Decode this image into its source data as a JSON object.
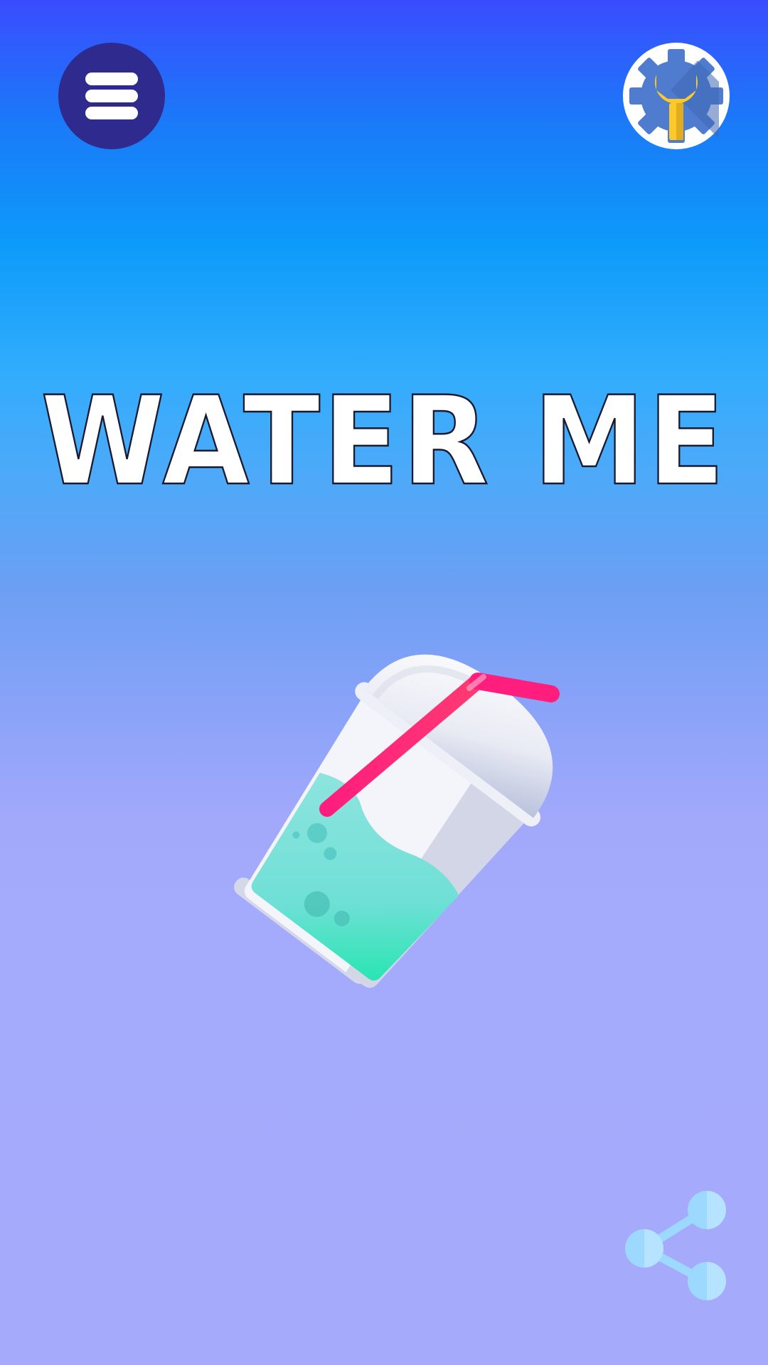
{
  "game": {
    "title": "WATER ME"
  },
  "toolbar": {
    "menu_icon": "hamburger-menu-icon",
    "settings_icon": "settings-wrench-gear-icon",
    "share_icon": "share-icon"
  },
  "colors": {
    "menu_button_bg": "#2e2a8e",
    "settings_gear": "#4f7ccf",
    "settings_wrench": "#fcc82b",
    "straw": "#ff1d7e",
    "liquid": "#22e3b1",
    "share_icon": "#9dd9ff"
  },
  "illustration": {
    "name": "cup-with-straw"
  }
}
